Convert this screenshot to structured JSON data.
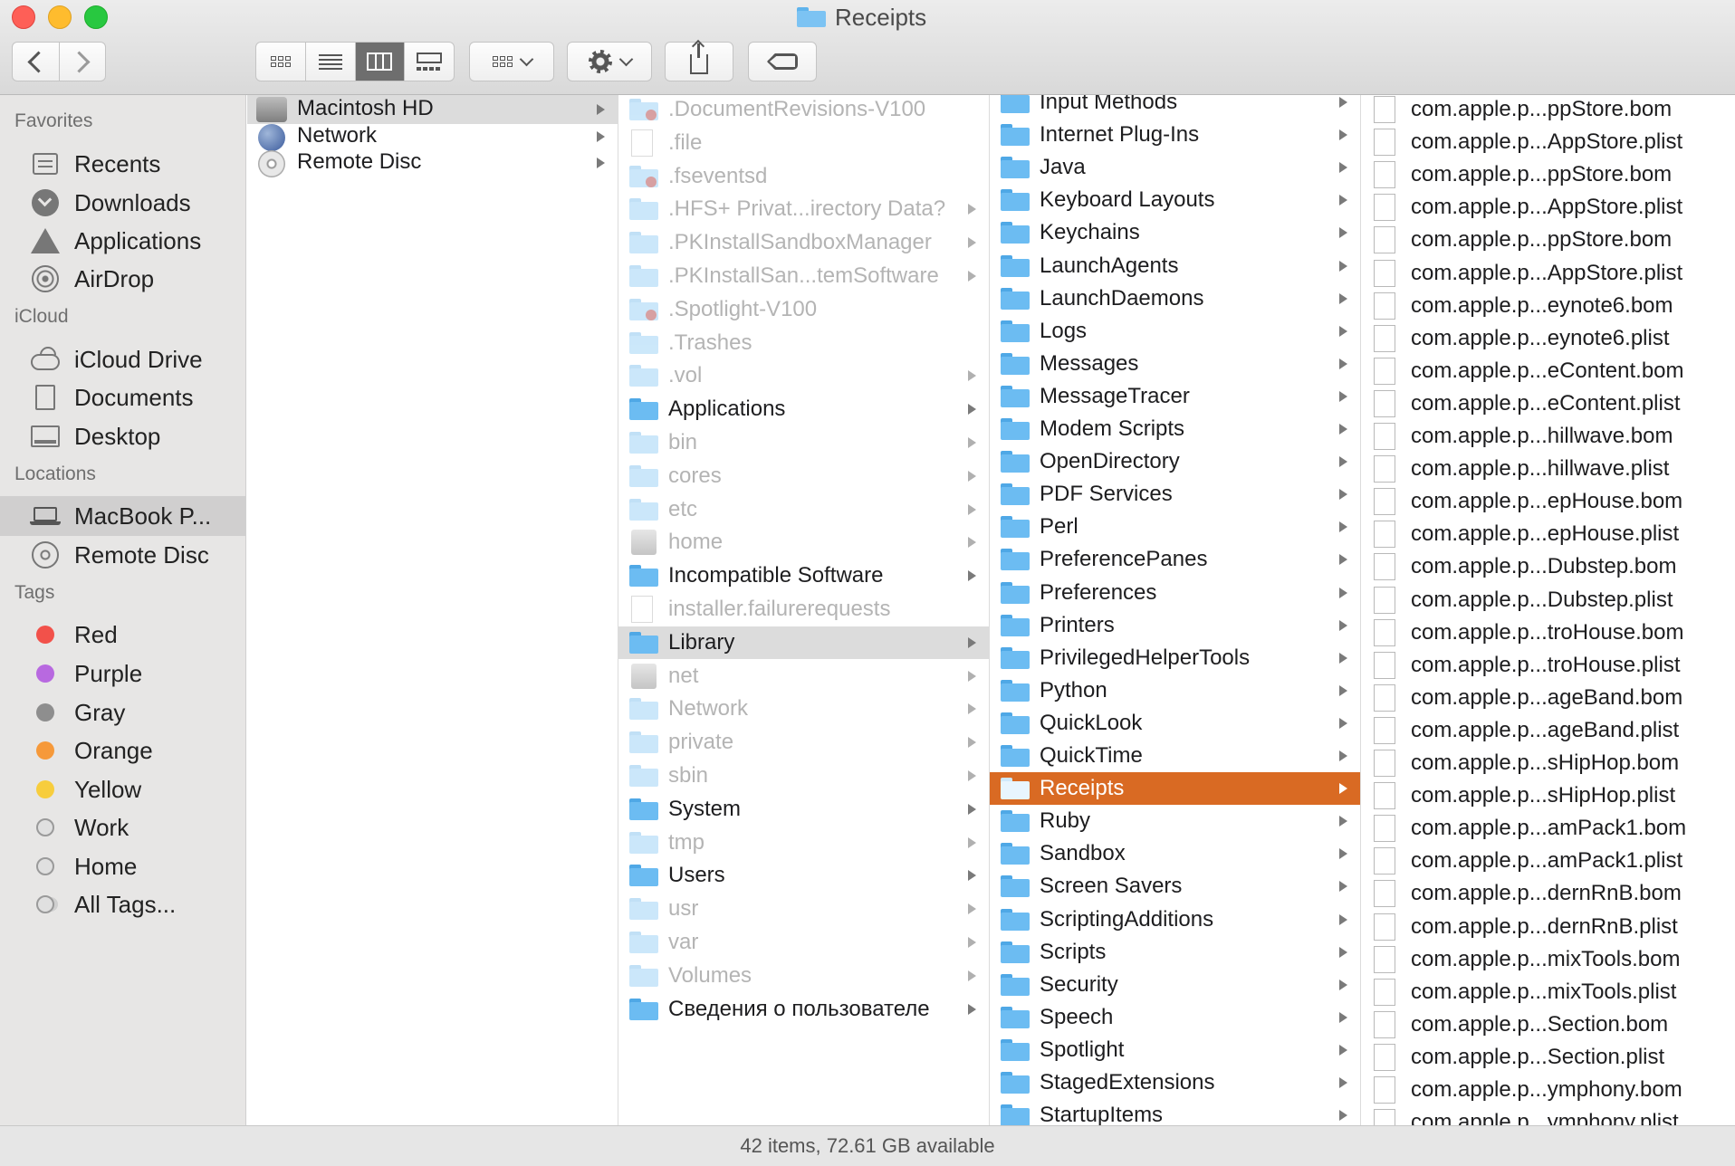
{
  "window": {
    "title": "Receipts"
  },
  "sidebar": {
    "favorites_header": "Favorites",
    "favorites": [
      {
        "label": "Recents",
        "icon": "recents-icon"
      },
      {
        "label": "Downloads",
        "icon": "downloads-icon"
      },
      {
        "label": "Applications",
        "icon": "applications-icon"
      },
      {
        "label": "AirDrop",
        "icon": "airdrop-icon"
      }
    ],
    "icloud_header": "iCloud",
    "icloud": [
      {
        "label": "iCloud Drive",
        "icon": "cloud-icon"
      },
      {
        "label": "Documents",
        "icon": "documents-icon"
      },
      {
        "label": "Desktop",
        "icon": "desktop-icon"
      }
    ],
    "locations_header": "Locations",
    "locations": [
      {
        "label": "MacBook P...",
        "icon": "laptop-icon",
        "selected": true
      },
      {
        "label": "Remote Disc",
        "icon": "disc-icon"
      }
    ],
    "tags_header": "Tags",
    "tags": [
      {
        "label": "Red",
        "color": "#f2514a"
      },
      {
        "label": "Purple",
        "color": "#b869e0"
      },
      {
        "label": "Gray",
        "color": "#8e8e8e"
      },
      {
        "label": "Orange",
        "color": "#f6993a"
      },
      {
        "label": "Yellow",
        "color": "#f7cd3d"
      },
      {
        "label": "Work",
        "color": ""
      },
      {
        "label": "Home",
        "color": ""
      },
      {
        "label": "All Tags...",
        "color": ""
      }
    ]
  },
  "columns": {
    "col1": [
      {
        "name": "Macintosh HD",
        "icon": "hd",
        "arrow": true,
        "selected": true
      },
      {
        "name": "Network",
        "icon": "globe",
        "arrow": true
      },
      {
        "name": "Remote Disc",
        "icon": "disc",
        "arrow": true
      }
    ],
    "col2": [
      {
        "name": ".DocumentRevisions-V100",
        "icon": "folder",
        "dim": true,
        "badge": true
      },
      {
        "name": ".file",
        "icon": "file",
        "dim": true
      },
      {
        "name": ".fseventsd",
        "icon": "folder",
        "dim": true,
        "badge": true
      },
      {
        "name": ".HFS+ Privat...irectory Data?",
        "icon": "folder",
        "dim": true,
        "arrow": true
      },
      {
        "name": ".PKInstallSandboxManager",
        "icon": "folder",
        "dim": true,
        "arrow": true
      },
      {
        "name": ".PKInstallSan...temSoftware",
        "icon": "folder",
        "dim": true,
        "arrow": true
      },
      {
        "name": ".Spotlight-V100",
        "icon": "folder",
        "dim": true,
        "badge": true
      },
      {
        "name": ".Trashes",
        "icon": "folder",
        "dim": true
      },
      {
        "name": ".vol",
        "icon": "folder",
        "dim": true,
        "arrow": true
      },
      {
        "name": "Applications",
        "icon": "folder",
        "arrow": true
      },
      {
        "name": "bin",
        "icon": "folder",
        "dim": true,
        "arrow": true
      },
      {
        "name": "cores",
        "icon": "folder",
        "dim": true,
        "arrow": true
      },
      {
        "name": "etc",
        "icon": "folder",
        "dim": true,
        "arrow": true
      },
      {
        "name": "home",
        "icon": "server",
        "dim": true,
        "arrow": true
      },
      {
        "name": "Incompatible Software",
        "icon": "folder",
        "arrow": true
      },
      {
        "name": "installer.failurerequests",
        "icon": "file",
        "dim": true
      },
      {
        "name": "Library",
        "icon": "folder",
        "arrow": true,
        "selected": true
      },
      {
        "name": "net",
        "icon": "server",
        "dim": true,
        "arrow": true
      },
      {
        "name": "Network",
        "icon": "folder",
        "dim": true,
        "arrow": true
      },
      {
        "name": "private",
        "icon": "folder",
        "dim": true,
        "arrow": true
      },
      {
        "name": "sbin",
        "icon": "folder",
        "dim": true,
        "arrow": true
      },
      {
        "name": "System",
        "icon": "folder",
        "arrow": true
      },
      {
        "name": "tmp",
        "icon": "folder",
        "dim": true,
        "arrow": true
      },
      {
        "name": "Users",
        "icon": "folder",
        "arrow": true
      },
      {
        "name": "usr",
        "icon": "folder",
        "dim": true,
        "arrow": true
      },
      {
        "name": "var",
        "icon": "folder",
        "dim": true,
        "arrow": true
      },
      {
        "name": "Volumes",
        "icon": "folder",
        "dim": true,
        "arrow": true
      },
      {
        "name": "Сведения о пользователе",
        "icon": "folder",
        "arrow": true
      }
    ],
    "col3": [
      {
        "name": "Input Methods",
        "icon": "folder",
        "arrow": true
      },
      {
        "name": "Internet Plug-Ins",
        "icon": "folder",
        "arrow": true
      },
      {
        "name": "Java",
        "icon": "folder",
        "arrow": true
      },
      {
        "name": "Keyboard Layouts",
        "icon": "folder",
        "arrow": true
      },
      {
        "name": "Keychains",
        "icon": "folder",
        "arrow": true
      },
      {
        "name": "LaunchAgents",
        "icon": "folder",
        "arrow": true
      },
      {
        "name": "LaunchDaemons",
        "icon": "folder",
        "arrow": true
      },
      {
        "name": "Logs",
        "icon": "folder",
        "arrow": true
      },
      {
        "name": "Messages",
        "icon": "folder",
        "arrow": true
      },
      {
        "name": "MessageTracer",
        "icon": "folder",
        "arrow": true
      },
      {
        "name": "Modem Scripts",
        "icon": "folder",
        "arrow": true
      },
      {
        "name": "OpenDirectory",
        "icon": "folder",
        "arrow": true
      },
      {
        "name": "PDF Services",
        "icon": "folder",
        "arrow": true
      },
      {
        "name": "Perl",
        "icon": "folder",
        "arrow": true
      },
      {
        "name": "PreferencePanes",
        "icon": "folder",
        "arrow": true
      },
      {
        "name": "Preferences",
        "icon": "folder",
        "arrow": true
      },
      {
        "name": "Printers",
        "icon": "folder",
        "arrow": true
      },
      {
        "name": "PrivilegedHelperTools",
        "icon": "folder",
        "arrow": true
      },
      {
        "name": "Python",
        "icon": "folder",
        "arrow": true
      },
      {
        "name": "QuickLook",
        "icon": "folder",
        "arrow": true
      },
      {
        "name": "QuickTime",
        "icon": "folder",
        "arrow": true
      },
      {
        "name": "Receipts",
        "icon": "folder",
        "arrow": true,
        "active": true
      },
      {
        "name": "Ruby",
        "icon": "folder",
        "arrow": true
      },
      {
        "name": "Sandbox",
        "icon": "folder",
        "arrow": true
      },
      {
        "name": "Screen Savers",
        "icon": "folder",
        "arrow": true
      },
      {
        "name": "ScriptingAdditions",
        "icon": "folder",
        "arrow": true
      },
      {
        "name": "Scripts",
        "icon": "folder",
        "arrow": true
      },
      {
        "name": "Security",
        "icon": "folder",
        "arrow": true
      },
      {
        "name": "Speech",
        "icon": "folder",
        "arrow": true
      },
      {
        "name": "Spotlight",
        "icon": "folder",
        "arrow": true
      },
      {
        "name": "StagedExtensions",
        "icon": "folder",
        "arrow": true
      },
      {
        "name": "StartupItems",
        "icon": "folder",
        "arrow": true
      }
    ],
    "col4": [
      {
        "name": "com.apple.p...ppStore.bom",
        "icon": "file"
      },
      {
        "name": "com.apple.p...AppStore.plist",
        "icon": "file"
      },
      {
        "name": "com.apple.p...ppStore.bom",
        "icon": "file"
      },
      {
        "name": "com.apple.p...AppStore.plist",
        "icon": "file"
      },
      {
        "name": "com.apple.p...ppStore.bom",
        "icon": "file"
      },
      {
        "name": "com.apple.p...AppStore.plist",
        "icon": "file"
      },
      {
        "name": "com.apple.p...eynote6.bom",
        "icon": "file"
      },
      {
        "name": "com.apple.p...eynote6.plist",
        "icon": "file"
      },
      {
        "name": "com.apple.p...eContent.bom",
        "icon": "file"
      },
      {
        "name": "com.apple.p...eContent.plist",
        "icon": "file"
      },
      {
        "name": "com.apple.p...hillwave.bom",
        "icon": "file"
      },
      {
        "name": "com.apple.p...hillwave.plist",
        "icon": "file"
      },
      {
        "name": "com.apple.p...epHouse.bom",
        "icon": "file"
      },
      {
        "name": "com.apple.p...epHouse.plist",
        "icon": "file"
      },
      {
        "name": "com.apple.p...Dubstep.bom",
        "icon": "file"
      },
      {
        "name": "com.apple.p...Dubstep.plist",
        "icon": "file"
      },
      {
        "name": "com.apple.p...troHouse.bom",
        "icon": "file"
      },
      {
        "name": "com.apple.p...troHouse.plist",
        "icon": "file"
      },
      {
        "name": "com.apple.p...ageBand.bom",
        "icon": "file"
      },
      {
        "name": "com.apple.p...ageBand.plist",
        "icon": "file"
      },
      {
        "name": "com.apple.p...sHipHop.bom",
        "icon": "file"
      },
      {
        "name": "com.apple.p...sHipHop.plist",
        "icon": "file"
      },
      {
        "name": "com.apple.p...amPack1.bom",
        "icon": "file"
      },
      {
        "name": "com.apple.p...amPack1.plist",
        "icon": "file"
      },
      {
        "name": "com.apple.p...dernRnB.bom",
        "icon": "file"
      },
      {
        "name": "com.apple.p...dernRnB.plist",
        "icon": "file"
      },
      {
        "name": "com.apple.p...mixTools.bom",
        "icon": "file"
      },
      {
        "name": "com.apple.p...mixTools.plist",
        "icon": "file"
      },
      {
        "name": "com.apple.p...Section.bom",
        "icon": "file"
      },
      {
        "name": "com.apple.p...Section.plist",
        "icon": "file"
      },
      {
        "name": "com.apple.p...ymphony.bom",
        "icon": "file"
      },
      {
        "name": "com.apple.p...ymphony.plist",
        "icon": "file"
      }
    ]
  },
  "status": {
    "text": "42 items, 72.61 GB available"
  },
  "colors": {
    "selection": "#d96a23",
    "folder": "#6cbcf2"
  }
}
